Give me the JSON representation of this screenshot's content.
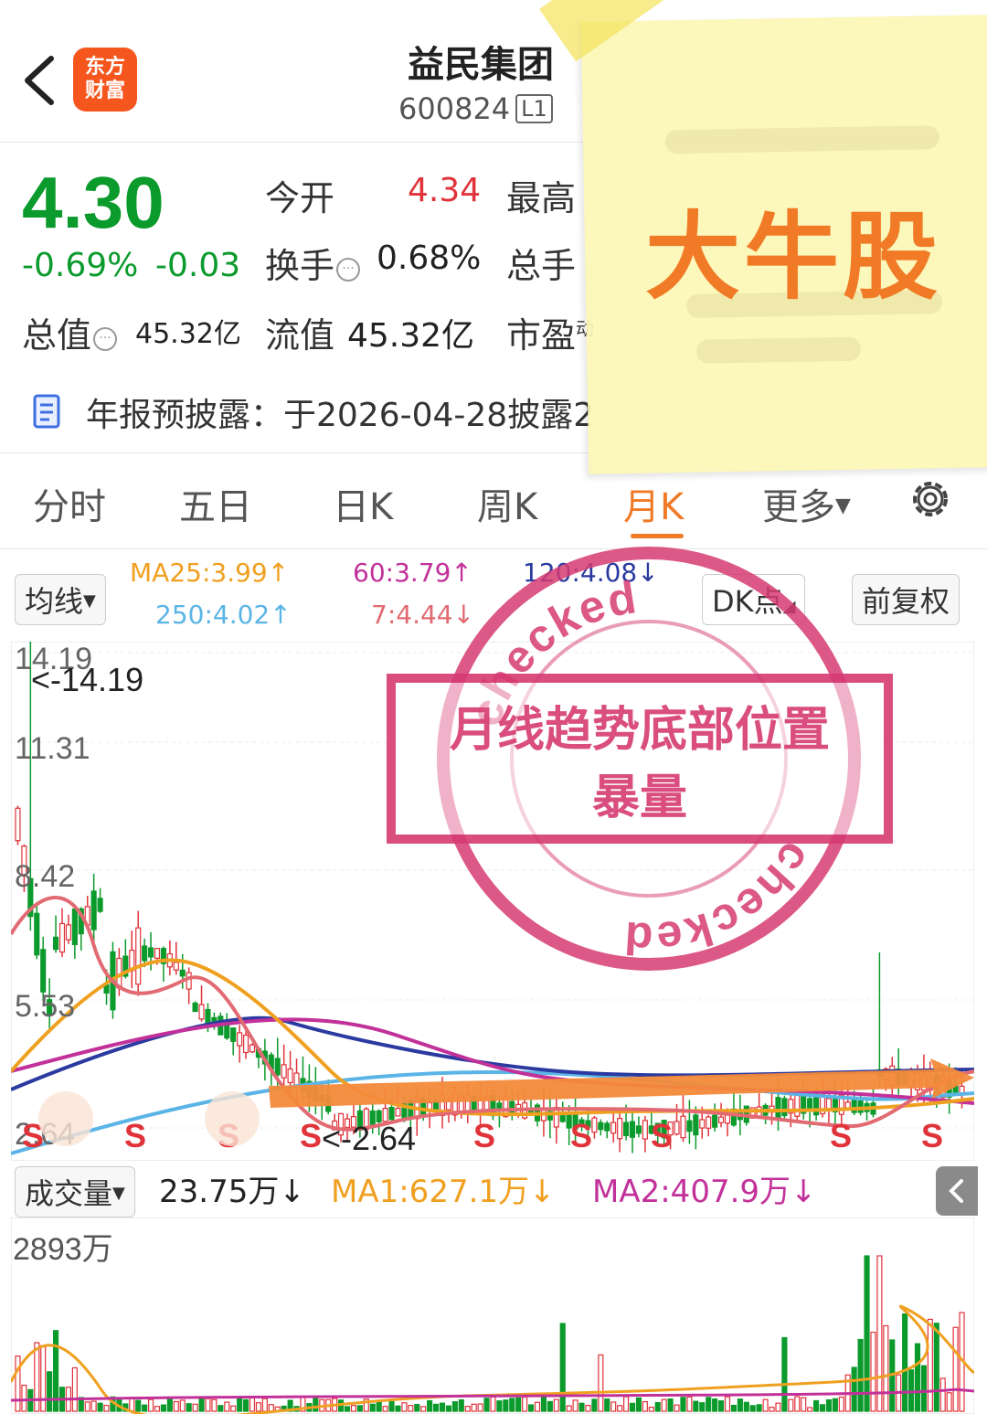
{
  "header": {
    "logo_line1": "东方",
    "logo_line2": "财富",
    "stock_name": "益民集团",
    "stock_code": "600824",
    "level": "L1"
  },
  "quote": {
    "price": "4.30",
    "change_pct": "-0.69%",
    "change_amt": "-0.03",
    "open_label": "今开",
    "open_value": "4.34",
    "high_label": "最高",
    "turnover_label": "换手",
    "turnover_value": "0.68%",
    "total_hands_label": "总手",
    "total_value_label": "总值",
    "total_value": "45.32亿",
    "float_value_label": "流值",
    "float_value": "45.32亿",
    "pe_label": "市盈",
    "pe_sup": "动",
    "colors": {
      "down": "#0b9a2c",
      "up": "#e0333a",
      "accent": "#f07a25"
    }
  },
  "notice": {
    "text": "年报预披露：于2026-04-28披露2"
  },
  "tabs": [
    {
      "label": "分时"
    },
    {
      "label": "五日"
    },
    {
      "label": "日K"
    },
    {
      "label": "周K"
    },
    {
      "label": "月K",
      "active": true
    },
    {
      "label": "更多"
    }
  ],
  "indicators": {
    "ma_dropdown": "均线",
    "ma25": "MA25:3.99↑",
    "ma60": "60:3.79↑",
    "ma120": "120:4.08↓",
    "ma250": "250:4.02↑",
    "ma7": "7:4.44↓",
    "dk_point": "DK点",
    "adjust": "前复权"
  },
  "kline": {
    "y_labels": [
      "14.19",
      "11.31",
      "8.42",
      "5.53",
      "2.64"
    ],
    "max_marker": "<-14.19",
    "min_marker": "<-2.64",
    "signal_letter": "S"
  },
  "volume": {
    "dropdown": "成交量",
    "current": "23.75万↓",
    "ma1": "MA1:627.1万↓",
    "ma2": "MA2:407.9万↓",
    "y_max": "2893万"
  },
  "overlay": {
    "sticky_note": "大牛股",
    "stamp_line1": "月线趋势底部位置",
    "stamp_line2": "暴量",
    "stamp_word": "checked"
  }
}
